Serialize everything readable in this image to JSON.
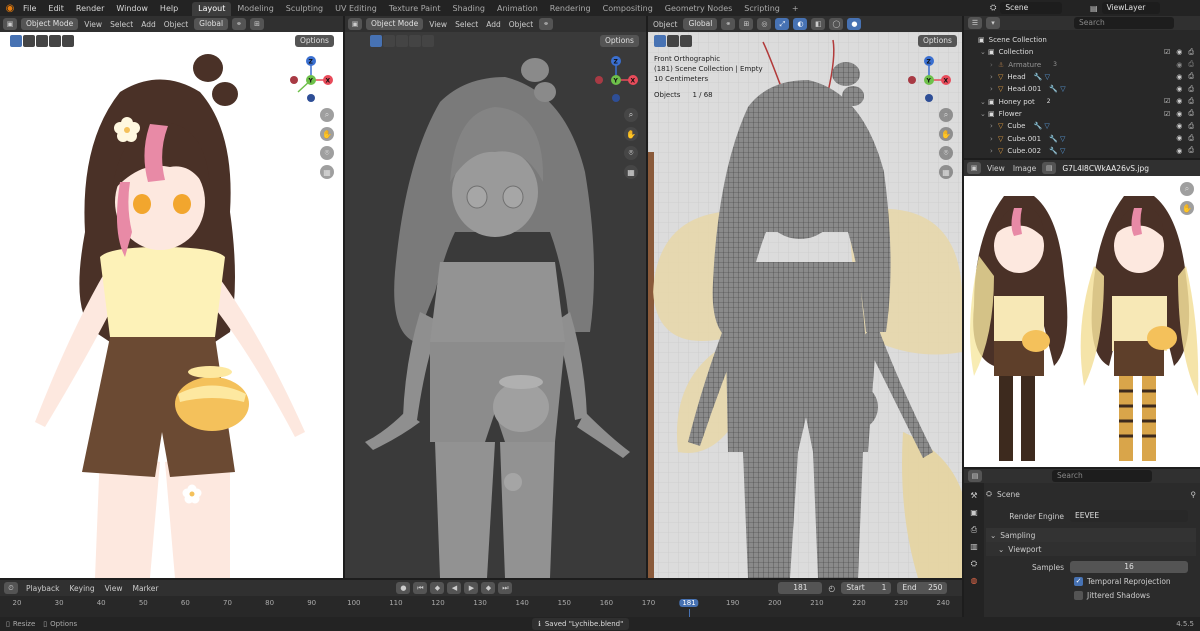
{
  "menubar": {
    "items": [
      "File",
      "Edit",
      "Render",
      "Window",
      "Help"
    ],
    "workspaces": [
      "Layout",
      "Modeling",
      "Sculpting",
      "UV Editing",
      "Texture Paint",
      "Shading",
      "Animation",
      "Rendering",
      "Compositing",
      "Geometry Nodes",
      "Scripting"
    ],
    "active_workspace": "Layout",
    "add_tab": "+",
    "scene": "Scene",
    "view_layer": "ViewLayer"
  },
  "viewport_left": {
    "mode": "Object Mode",
    "menus": [
      "View",
      "Select",
      "Add",
      "Object"
    ],
    "orientation": "Global",
    "options": "Options"
  },
  "viewport_mid": {
    "mode": "Object Mode",
    "menus": [
      "View",
      "Select",
      "Add",
      "Object"
    ],
    "options": "Options"
  },
  "viewport_right": {
    "menus": [
      "Object"
    ],
    "orientation": "Global",
    "options": "Options",
    "overlay_lines": [
      "Front Orthographic",
      "(181) Scene Collection | Empty",
      "10 Centimeters"
    ],
    "objects_label": "Objects",
    "objects_value": "1 / 68"
  },
  "gizmo": {
    "z": "Z",
    "y": "Y",
    "x": "X"
  },
  "outliner": {
    "search_placeholder": "Search",
    "rows": [
      {
        "label": "Scene Collection",
        "indent": 0,
        "type": "collection"
      },
      {
        "label": "Collection",
        "indent": 1,
        "type": "collection"
      },
      {
        "label": "Armature",
        "indent": 2,
        "type": "armature",
        "dim": true,
        "extra": "3"
      },
      {
        "label": "Head",
        "indent": 2,
        "type": "mesh"
      },
      {
        "label": "Head.001",
        "indent": 2,
        "type": "mesh"
      },
      {
        "label": "Honey pot",
        "indent": 1,
        "type": "collection",
        "extra": "2"
      },
      {
        "label": "Flower",
        "indent": 1,
        "type": "collection"
      },
      {
        "label": "Cube",
        "indent": 2,
        "type": "mesh"
      },
      {
        "label": "Cube.001",
        "indent": 2,
        "type": "mesh"
      },
      {
        "label": "Cube.002",
        "indent": 2,
        "type": "mesh"
      }
    ]
  },
  "image_editor": {
    "menus": [
      "View",
      "Image"
    ],
    "image_name": "G7L4I8CWkAA26vS.jpg"
  },
  "properties": {
    "search_placeholder": "Search",
    "scene_label": "Scene",
    "render_engine_label": "Render Engine",
    "render_engine_value": "EEVEE",
    "sampling": "Sampling",
    "viewport": "Viewport",
    "samples_label": "Samples",
    "samples_value": "16",
    "temporal_reprojection": "Temporal Reprojection",
    "temporal_checked": true,
    "jittered_shadows": "Jittered Shadows",
    "jittered_checked": false
  },
  "timeline": {
    "menus": [
      "Playback",
      "Keying",
      "View",
      "Marker"
    ],
    "current_frame": "181",
    "start_label": "Start",
    "start_value": "1",
    "end_label": "End",
    "end_value": "250",
    "ticks": [
      "20",
      "30",
      "40",
      "50",
      "60",
      "70",
      "80",
      "90",
      "100",
      "110",
      "120",
      "130",
      "140",
      "150",
      "160",
      "170",
      "181",
      "190",
      "200",
      "210",
      "220",
      "230",
      "240"
    ]
  },
  "status": {
    "left1": "Resize",
    "left2": "Options",
    "message": "Saved \"Lychibe.blend\"",
    "version": "4.5.5"
  },
  "colors": {
    "accent": "#4772b3",
    "frame_blue": "#4772b3",
    "hair": "#4a3127",
    "hair_pink": "#e88aa6",
    "shirt": "#fdf2b8",
    "shorts": "#6b4a33",
    "skin": "#fde8df",
    "honey": "#f4c15b"
  }
}
